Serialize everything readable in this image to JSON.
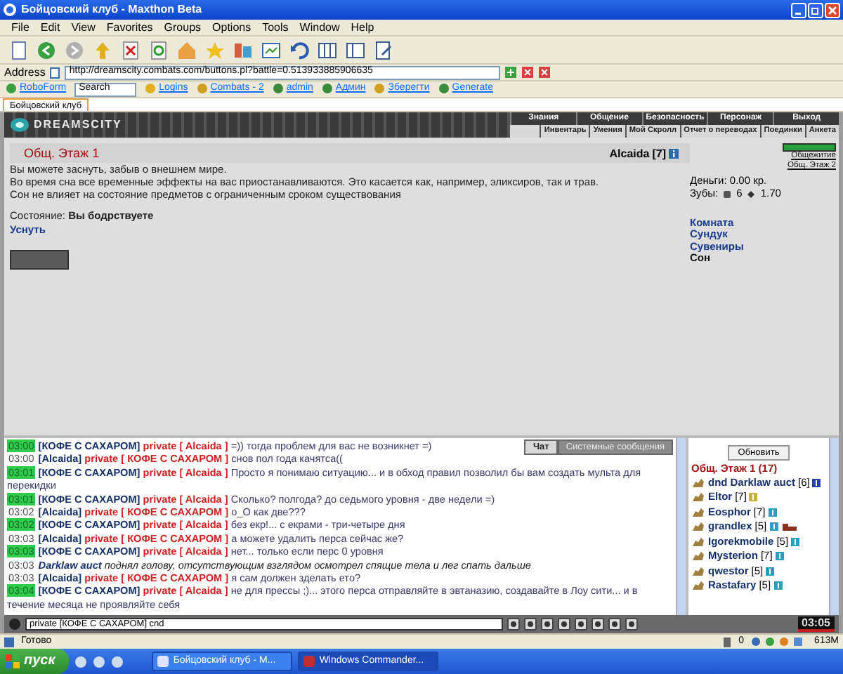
{
  "window": {
    "title": "Бойцовский клуб - Maxthon Beta"
  },
  "menu": [
    "File",
    "Edit",
    "View",
    "Favorites",
    "Groups",
    "Options",
    "Tools",
    "Window",
    "Help"
  ],
  "address_bar": {
    "label": "Address",
    "url": "http://dreamscity.combats.com/buttons.pl?battle=0.513933885906635"
  },
  "links_bar": [
    {
      "kind": "link",
      "label": "RoboForm"
    },
    {
      "kind": "search",
      "value": "Search"
    },
    {
      "kind": "link",
      "label": "Logins"
    },
    {
      "kind": "link",
      "label": "Combats - 2"
    },
    {
      "kind": "link",
      "label": "admin"
    },
    {
      "kind": "link",
      "label": "Админ"
    },
    {
      "kind": "link",
      "label": "Зберегти"
    },
    {
      "kind": "link",
      "label": "Generate"
    }
  ],
  "browser_tabs": [
    {
      "label": "Бойцовский клуб",
      "selected": true
    }
  ],
  "game": {
    "logo": "DREAMSCITY",
    "nav_top": [
      "Знания",
      "Общение",
      "Безопасность",
      "Персонаж",
      "Выход"
    ],
    "nav_bottom": [
      "Инвентарь",
      "Умения",
      "Мой Скролл",
      "Отчет о переводах",
      "Поединки",
      "Анкета"
    ]
  },
  "room": {
    "title": "Общ. Этаж 1",
    "description": [
      "Вы можете заснуть, забыв о внешнем мире.",
      "Во время сна все временные эффекты на вас приостанавливаются. Это касается как, например, эликсиров, так и трав.",
      "Сон не влияет на состояние предметов с ограниченным сроком существования"
    ],
    "state_label": "Состояние:",
    "state_value": "Вы бодрствуете",
    "action": "Уснуть"
  },
  "character": {
    "name": "Alcaida",
    "rank": "[7]",
    "money": "Деньги: 0.00 кр.",
    "teeth_label": "Зубы:",
    "teeth": [
      "6",
      "1.70"
    ],
    "links": [
      {
        "label": "Комната",
        "selected": false
      },
      {
        "label": "Сундук",
        "selected": false
      },
      {
        "label": "Сувениры",
        "selected": false
      },
      {
        "label": "Сон",
        "selected": true
      }
    ]
  },
  "location": {
    "hp": {
      "level": 1
    },
    "links": [
      "Общежитие",
      "Общ. Этаж 2"
    ]
  },
  "chat": {
    "tabs": [
      {
        "label": "Чат",
        "selected": true
      },
      {
        "label": "Системные сообщения",
        "selected": false
      }
    ],
    "messages": [
      {
        "kind": "private",
        "time": "03:00",
        "highlighted": true,
        "sender": "[КОФЕ С САХАРОМ]",
        "to": "private [ Alcaida ]",
        "text": "=)) тогда проблем для вас не возникнет =)"
      },
      {
        "kind": "private",
        "time": "03:00",
        "highlighted": false,
        "sender": "[Alcaida]",
        "to": "private [ КОФЕ С САХАРОМ ]",
        "text": "снов пол года качятса(("
      },
      {
        "kind": "private",
        "time": "03:01",
        "highlighted": true,
        "sender": "[КОФЕ С САХАРОМ]",
        "to": "private [ Alcaida ]",
        "text": "Просто я понимаю ситуацию... и в обход правил позволил бы вам создать мульта для перекидки"
      },
      {
        "kind": "private",
        "time": "03:01",
        "highlighted": true,
        "sender": "[КОФЕ С САХАРОМ]",
        "to": "private [ Alcaida ]",
        "text": "Сколько? полгода? до седьмого уровня - две недели =)"
      },
      {
        "kind": "private",
        "time": "03:02",
        "highlighted": false,
        "sender": "[Alcaida]",
        "to": "private [ КОФЕ С САХАРОМ ]",
        "text": "о_О как две???"
      },
      {
        "kind": "private",
        "time": "03:02",
        "highlighted": true,
        "sender": "[КОФЕ С САХАРОМ]",
        "to": "private [ Alcaida ]",
        "text": "без екр!... с екрами - три-четыре дня"
      },
      {
        "kind": "private",
        "time": "03:03",
        "highlighted": false,
        "sender": "[Alcaida]",
        "to": "private [ КОФЕ С САХАРОМ ]",
        "text": "а можете удалить перса сейчас же?"
      },
      {
        "kind": "private",
        "time": "03:03",
        "highlighted": true,
        "sender": "[КОФЕ С САХАРОМ]",
        "to": "private [ Alcaida ]",
        "text": "нет... только если перс 0 уровня"
      },
      {
        "kind": "emote",
        "time": "03:03",
        "highlighted": false,
        "sender": "Darklaw auct",
        "text": "поднял голову, отсутствующим взглядом осмотрел спящие тела и лег спать дальше"
      },
      {
        "kind": "private",
        "time": "03:03",
        "highlighted": false,
        "sender": "[Alcaida]",
        "to": "private [ КОФЕ С САХАРОМ ]",
        "text": "я сам должен зделать ето?"
      },
      {
        "kind": "private",
        "time": "03:04",
        "highlighted": true,
        "sender": "[КОФЕ С САХАРОМ]",
        "to": "private [ Alcaida ]",
        "text": "не для прессы ;)... этого перса отправляйте в эвтаназию, создавайте в Лоу сити... и в течение месяца не проявляйте себя"
      }
    ],
    "input": "private [КОФЕ С САХАРОМ] cnd"
  },
  "online": {
    "refresh": "Обновить",
    "title": "Общ. Этаж 1 (17)",
    "users": [
      {
        "status": "dnd",
        "name": "Darklaw auct",
        "rank": "[6]",
        "color": "#2a3fb0",
        "item_icon": false
      },
      {
        "name": "Eltor",
        "rank": "[7]",
        "color": "#c8b040",
        "item_icon": false
      },
      {
        "name": "Eosphor",
        "rank": "[7]",
        "color": "#2a9fc0",
        "item_icon": false
      },
      {
        "name": "grandlex",
        "rank": "[5]",
        "color": "#2a9fc0",
        "item_icon": true
      },
      {
        "name": "Igorekmobile",
        "rank": "[5]",
        "color": "#2a9fc0",
        "item_icon": false
      },
      {
        "name": "Mysterion",
        "rank": "[7]",
        "color": "#2a9fc0",
        "item_icon": false
      },
      {
        "name": "qwestor",
        "rank": "[5]",
        "color": "#2a9fc0",
        "item_icon": false
      },
      {
        "name": "Rastafary",
        "rank": "[5]",
        "color": "#2a9fc0",
        "item_icon": false
      }
    ]
  },
  "clock": "03:05",
  "status_bar": {
    "text": "Готово",
    "count": "0",
    "memory": "613M"
  },
  "taskbar": {
    "start": "пуск",
    "tasks": [
      {
        "label": "Бойцовский клуб - M...",
        "selected": false
      },
      {
        "label": "Windows Commander...",
        "selected": true
      }
    ]
  }
}
